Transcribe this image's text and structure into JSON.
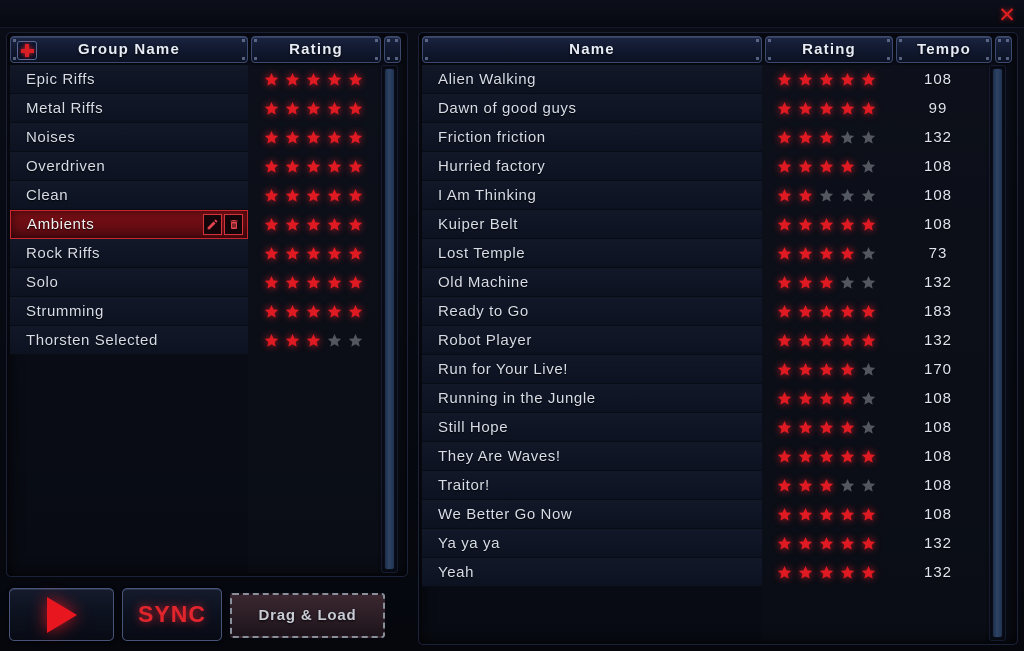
{
  "window": {
    "close_label": "✕"
  },
  "left_panel": {
    "add_icon": "plus-icon",
    "columns": [
      {
        "label": "Group Name",
        "key": "name"
      },
      {
        "label": "Rating",
        "key": "rating"
      }
    ],
    "selected_row_index": 5,
    "row_action_icons": [
      "pencil-icon",
      "trash-icon"
    ],
    "rows": [
      {
        "name": "Epic Riffs",
        "rating": 5
      },
      {
        "name": "Metal Riffs",
        "rating": 5
      },
      {
        "name": "Noises",
        "rating": 5
      },
      {
        "name": "Overdriven",
        "rating": 5
      },
      {
        "name": "Clean",
        "rating": 5
      },
      {
        "name": "Ambients",
        "rating": 5
      },
      {
        "name": "Rock Riffs",
        "rating": 5
      },
      {
        "name": "Solo",
        "rating": 5
      },
      {
        "name": "Strumming",
        "rating": 5
      },
      {
        "name": "Thorsten Selected",
        "rating": 3
      }
    ]
  },
  "right_panel": {
    "columns": [
      {
        "label": "Name",
        "key": "name"
      },
      {
        "label": "Rating",
        "key": "rating"
      },
      {
        "label": "Tempo",
        "key": "tempo"
      }
    ],
    "rows": [
      {
        "name": "Alien Walking",
        "rating": 5,
        "tempo": "108"
      },
      {
        "name": "Dawn of good guys",
        "rating": 5,
        "tempo": "99"
      },
      {
        "name": "Friction friction",
        "rating": 3,
        "tempo": "132"
      },
      {
        "name": "Hurried factory",
        "rating": 4,
        "tempo": "108"
      },
      {
        "name": "I Am Thinking",
        "rating": 2,
        "tempo": "108"
      },
      {
        "name": "Kuiper Belt",
        "rating": 5,
        "tempo": "108"
      },
      {
        "name": "Lost Temple",
        "rating": 4,
        "tempo": "73"
      },
      {
        "name": "Old Machine",
        "rating": 3,
        "tempo": "132"
      },
      {
        "name": "Ready to Go",
        "rating": 5,
        "tempo": "183"
      },
      {
        "name": "Robot Player",
        "rating": 5,
        "tempo": "132"
      },
      {
        "name": "Run for Your Live!",
        "rating": 4,
        "tempo": "170"
      },
      {
        "name": "Running in the Jungle",
        "rating": 4,
        "tempo": "108"
      },
      {
        "name": "Still Hope",
        "rating": 4,
        "tempo": "108"
      },
      {
        "name": "They Are Waves!",
        "rating": 5,
        "tempo": "108"
      },
      {
        "name": "Traitor!",
        "rating": 3,
        "tempo": "108"
      },
      {
        "name": "We Better Go Now",
        "rating": 5,
        "tempo": "108"
      },
      {
        "name": "Ya ya ya",
        "rating": 5,
        "tempo": "132"
      },
      {
        "name": "Yeah",
        "rating": 5,
        "tempo": "132"
      }
    ]
  },
  "toolbar": {
    "play_label": "play-icon",
    "sync_label": "SYNC",
    "dragload_label": "Drag & Load"
  },
  "colors": {
    "accent_red": "#d81f26",
    "star_on": "#e01a22",
    "star_off": "#6b6f78",
    "selection": "#7d1016",
    "panel_bg": "#0b0e18",
    "header_text": "#e8ecf6"
  },
  "rating_max": 5
}
